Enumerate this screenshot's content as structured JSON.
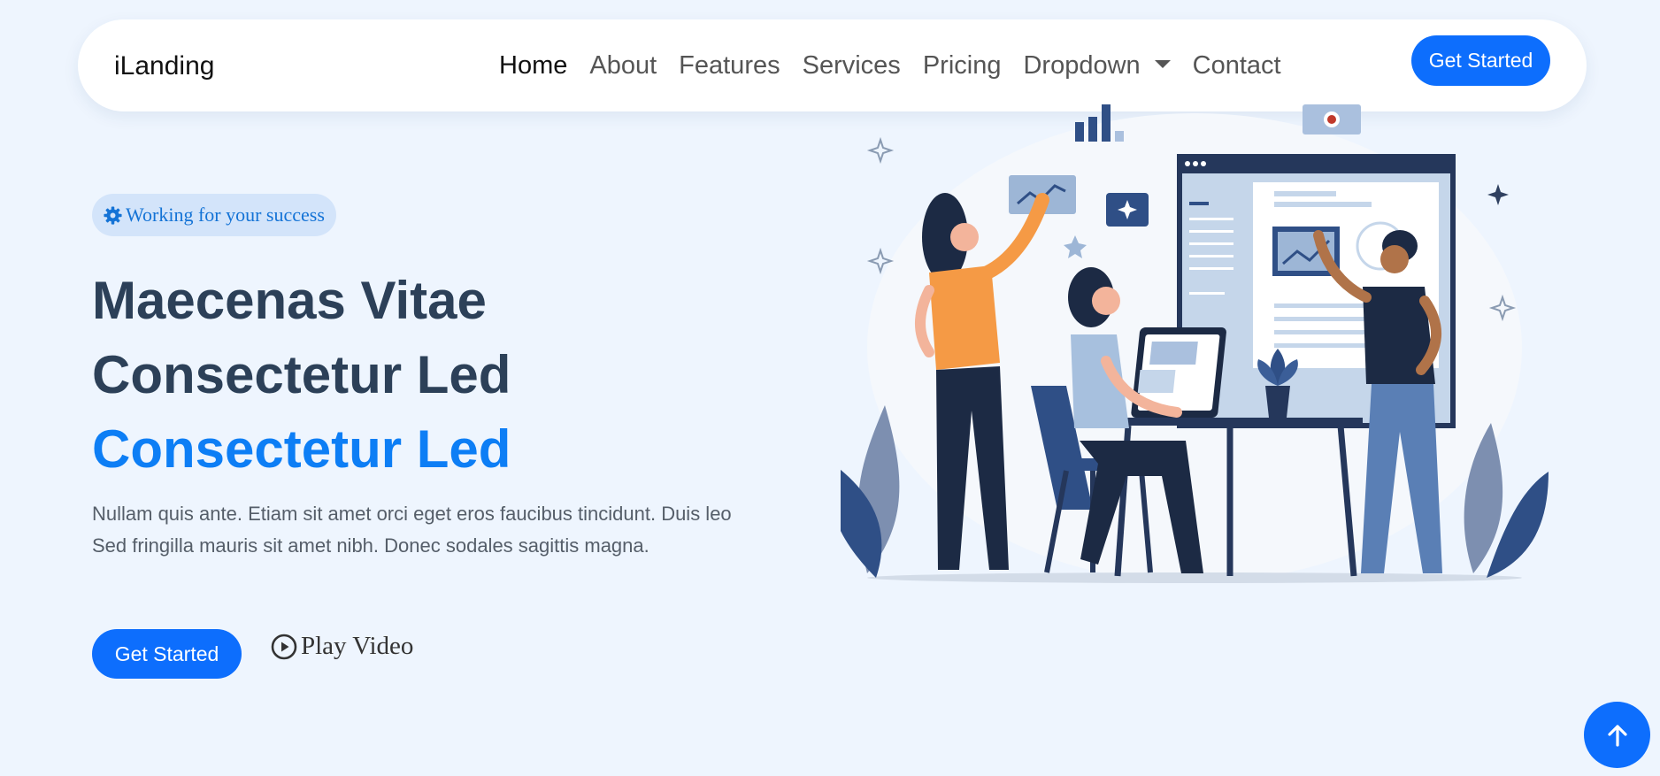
{
  "brand": {
    "name": "iLanding"
  },
  "nav": {
    "items": [
      {
        "label": "Home",
        "active": true
      },
      {
        "label": "About"
      },
      {
        "label": "Features"
      },
      {
        "label": "Services"
      },
      {
        "label": "Pricing"
      },
      {
        "label": "Dropdown",
        "has_dropdown": true
      },
      {
        "label": "Contact"
      }
    ],
    "cta_label": "Get Started"
  },
  "hero": {
    "badge_icon": "gear-icon",
    "badge_text": "Working for your success",
    "title_line1": "Maecenas Vitae",
    "title_line2": "Consectetur Led",
    "title_line3_accent": "Consectetur Led",
    "description_line1": "Nullam quis ante. Etiam sit amet orci eget eros faucibus tincidunt. Duis leo",
    "description_line2": "Sed fringilla mauris sit amet nibh. Donec sodales sagittis magna.",
    "primary_button": "Get Started",
    "video_button": "Play Video",
    "video_icon": "play-circle-icon"
  },
  "scroll_top_icon": "arrow-up-icon",
  "colors": {
    "accent": "#0d6efd",
    "accent_text": "#0d7ef5",
    "heading": "#2c4058",
    "background": "#eef5fe"
  }
}
